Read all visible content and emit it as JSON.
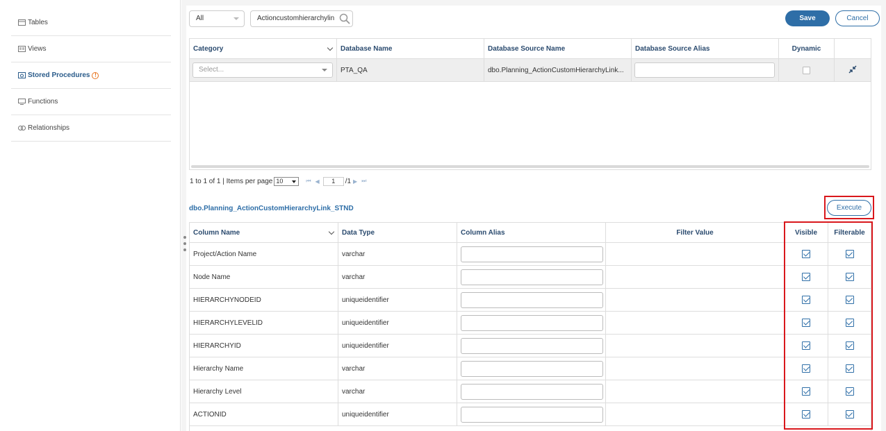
{
  "sidebar": {
    "items": [
      {
        "label": "Tables",
        "icon": "table-icon",
        "active": false
      },
      {
        "label": "Views",
        "icon": "view-icon",
        "active": false
      },
      {
        "label": "Stored Procedures",
        "icon": "stored-procedure-icon",
        "active": true,
        "warning": "!"
      },
      {
        "label": "Functions",
        "icon": "function-icon",
        "active": false
      },
      {
        "label": "Relationships",
        "icon": "relationship-icon",
        "active": false
      }
    ]
  },
  "toolbar": {
    "filter_value": "All",
    "search_value": "Actioncustomhierarchylin",
    "save_label": "Save",
    "cancel_label": "Cancel"
  },
  "source_grid": {
    "headers": {
      "category": "Category",
      "database_name": "Database Name",
      "database_source_name": "Database Source Name",
      "database_source_alias": "Database Source Alias",
      "dynamic": "Dynamic"
    },
    "row": {
      "category_placeholder": "Select...",
      "database_name": "PTA_QA",
      "database_source_name": "dbo.Planning_ActionCustomHierarchyLink...",
      "database_source_alias": "",
      "dynamic": false
    }
  },
  "pager": {
    "summary": "1 to 1 of 1 | Items per page",
    "items_per_page": "10",
    "current_page": "1",
    "total_pages": "/1"
  },
  "procedure": {
    "title": "dbo.Planning_ActionCustomHierarchyLink_STND",
    "execute_label": "Execute"
  },
  "columns_grid": {
    "headers": {
      "column_name": "Column Name",
      "data_type": "Data Type",
      "column_alias": "Column Alias",
      "filter_value": "Filter Value",
      "visible": "Visible",
      "filterable": "Filterable"
    },
    "rows": [
      {
        "name": "Project/Action Name",
        "type": "varchar",
        "visible": true,
        "filterable": true
      },
      {
        "name": "Node Name",
        "type": "varchar",
        "visible": true,
        "filterable": true
      },
      {
        "name": "HIERARCHYNODEID",
        "type": "uniqueidentifier",
        "visible": true,
        "filterable": true
      },
      {
        "name": "HIERARCHYLEVELID",
        "type": "uniqueidentifier",
        "visible": true,
        "filterable": true
      },
      {
        "name": "HIERARCHYID",
        "type": "uniqueidentifier",
        "visible": true,
        "filterable": true
      },
      {
        "name": "Hierarchy Name",
        "type": "varchar",
        "visible": true,
        "filterable": true
      },
      {
        "name": "Hierarchy Level",
        "type": "varchar",
        "visible": true,
        "filterable": true
      },
      {
        "name": "ACTIONID",
        "type": "uniqueidentifier",
        "visible": true,
        "filterable": true
      }
    ]
  },
  "colors": {
    "accent": "#2e6ea7",
    "highlight": "#d9171c",
    "warning": "#e8731d"
  }
}
